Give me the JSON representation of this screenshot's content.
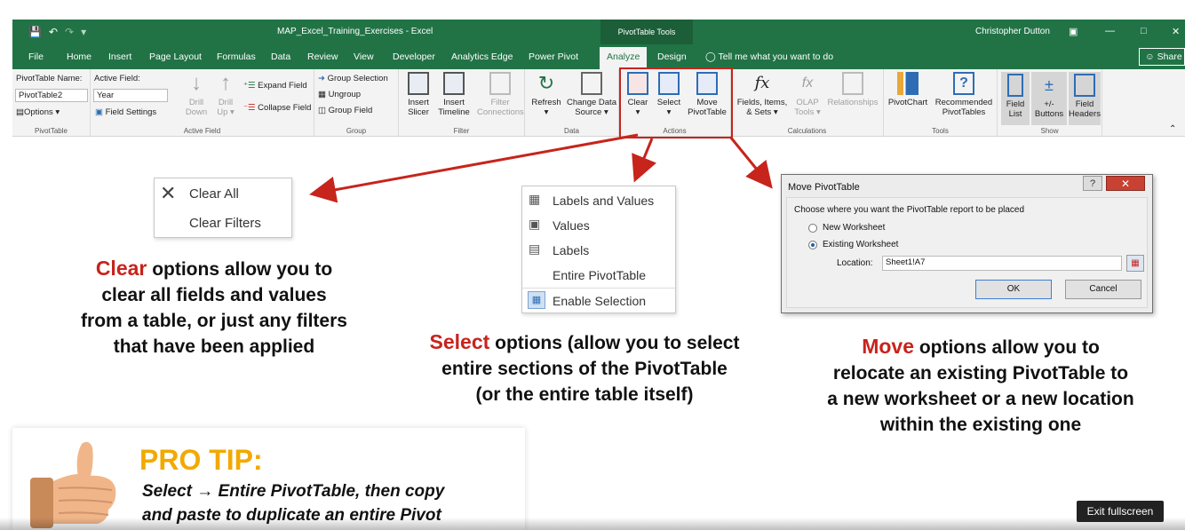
{
  "titlebar": {
    "doc_title": "MAP_Excel_Training_Exercises - Excel",
    "context_band": "PivotTable Tools",
    "user": "Christopher Dutton"
  },
  "tabs": [
    {
      "label": "File"
    },
    {
      "label": "Home"
    },
    {
      "label": "Insert"
    },
    {
      "label": "Page Layout"
    },
    {
      "label": "Formulas"
    },
    {
      "label": "Data"
    },
    {
      "label": "Review"
    },
    {
      "label": "View"
    },
    {
      "label": "Developer"
    },
    {
      "label": "Analytics Edge"
    },
    {
      "label": "Power Pivot"
    },
    {
      "label": "Analyze"
    },
    {
      "label": "Design"
    }
  ],
  "tell_me": "Tell me what you want to do",
  "share": "Share",
  "ribbon": {
    "pivottable": {
      "name_label": "PivotTable Name:",
      "name_value": "PivotTable2",
      "options": "Options",
      "group": "PivotTable"
    },
    "active_field": {
      "label": "Active Field:",
      "value": "Year",
      "field_settings": "Field Settings",
      "drill_down_1": "Drill",
      "drill_down_2": "Down",
      "drill_up_1": "Drill",
      "drill_up_2": "Up",
      "expand": "Expand Field",
      "collapse": "Collapse Field",
      "group": "Active Field"
    },
    "group_grp": {
      "group_selection": "Group Selection",
      "ungroup": "Ungroup",
      "group_field": "Group Field",
      "group": "Group"
    },
    "filter": {
      "slicer_1": "Insert",
      "slicer_2": "Slicer",
      "timeline_1": "Insert",
      "timeline_2": "Timeline",
      "conn_1": "Filter",
      "conn_2": "Connections",
      "group": "Filter"
    },
    "data": {
      "refresh": "Refresh",
      "change_1": "Change Data",
      "change_2": "Source",
      "group": "Data"
    },
    "actions": {
      "clear": "Clear",
      "select": "Select",
      "move_1": "Move",
      "move_2": "PivotTable",
      "group": "Actions"
    },
    "calculations": {
      "fields_1": "Fields, Items,",
      "fields_2": "& Sets",
      "olap_1": "OLAP",
      "olap_2": "Tools",
      "relationships": "Relationships",
      "group": "Calculations"
    },
    "tools": {
      "pivotchart": "PivotChart",
      "rec_1": "Recommended",
      "rec_2": "PivotTables",
      "group": "Tools"
    },
    "show": {
      "fl_1": "Field",
      "fl_2": "List",
      "pm_1": "+/-",
      "pm_2": "Buttons",
      "fh_1": "Field",
      "fh_2": "Headers",
      "group": "Show"
    }
  },
  "clear_menu": {
    "clear_all": "Clear All",
    "clear_filters": "Clear Filters"
  },
  "select_menu": {
    "labels_values": "Labels and Values",
    "values": "Values",
    "labels": "Labels",
    "entire": "Entire PivotTable",
    "enable": "Enable Selection"
  },
  "dialog": {
    "title": "Move PivotTable",
    "prompt": "Choose where you want the PivotTable report to be placed",
    "new_ws": "New Worksheet",
    "existing_ws": "Existing Worksheet",
    "location_label": "Location:",
    "location_value": "Sheet1!A7",
    "ok": "OK",
    "cancel": "Cancel"
  },
  "captions": {
    "clear_kw": "Clear",
    "clear_l1": " options allow you to",
    "clear_l2": "clear all fields and values",
    "clear_l3": "from a table, or just any filters",
    "clear_l4": "that have been applied",
    "select_kw": "Select",
    "select_l1": " options (allow you to select",
    "select_l2": "entire sections of the PivotTable",
    "select_l3": "(or the entire table itself)",
    "move_kw": "Move",
    "move_l1": " options allow you to",
    "move_l2": "relocate an existing PivotTable to",
    "move_l3": "a new worksheet or a new location",
    "move_l4": "within the existing one"
  },
  "protip": {
    "pro": "PRO",
    "tip": " TIP:",
    "line1": "Select → Entire PivotTable, then copy",
    "line2": "and paste to duplicate an entire Pivot"
  },
  "exit_fullscreen": "Exit fullscreen",
  "colors": {
    "excel_green": "#217346",
    "accent_red": "#c7241c",
    "pro_tip_gold": "#f2a900"
  }
}
